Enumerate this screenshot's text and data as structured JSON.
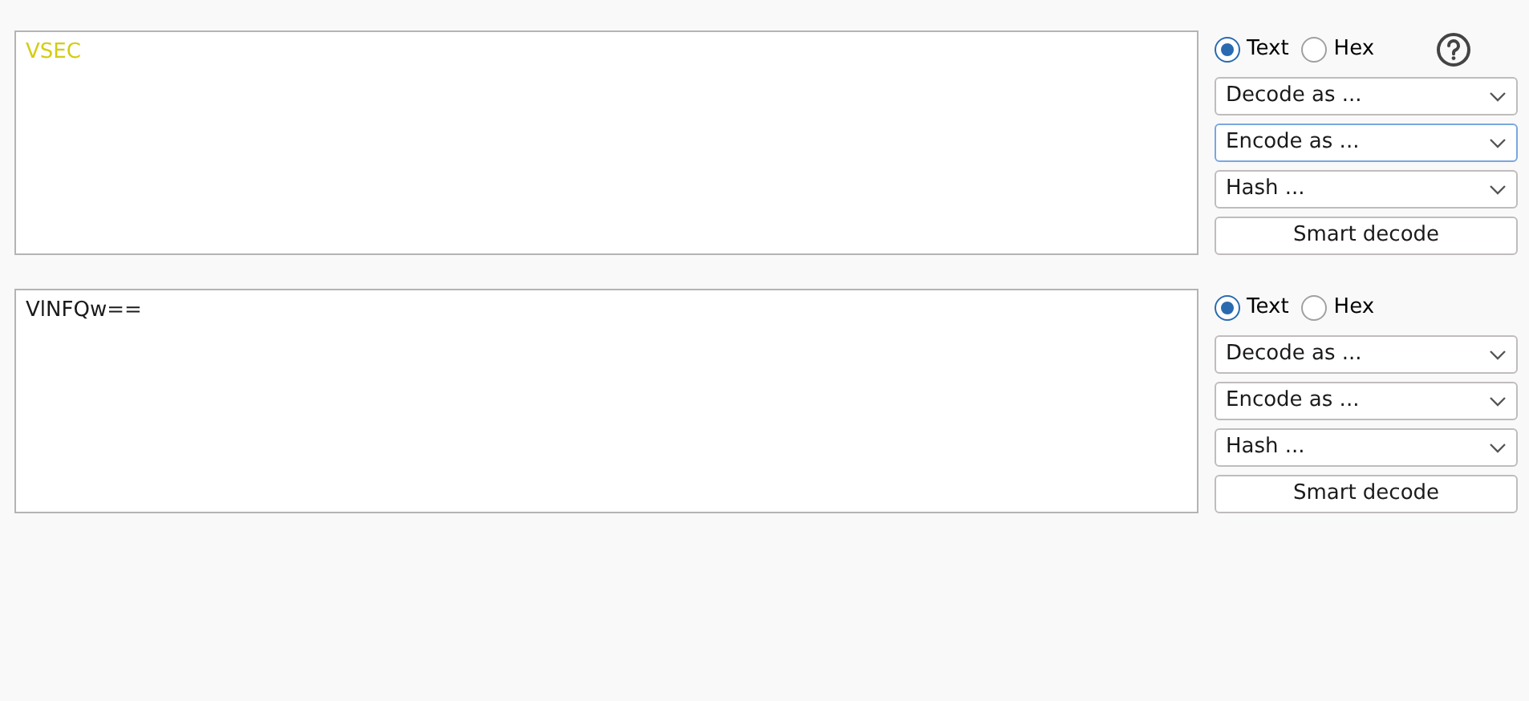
{
  "panels": [
    {
      "text": "VSEC",
      "highlighted": true,
      "help": true,
      "formats": [
        {
          "label": "Text",
          "selected": true
        },
        {
          "label": "Hex",
          "selected": false
        }
      ],
      "selects": [
        {
          "label": "Decode as ...",
          "focused": false
        },
        {
          "label": "Encode as ...",
          "focused": true
        },
        {
          "label": "Hash ...",
          "focused": false
        }
      ],
      "button": "Smart decode"
    },
    {
      "text": "VlNFQw==",
      "highlighted": false,
      "help": false,
      "formats": [
        {
          "label": "Text",
          "selected": true
        },
        {
          "label": "Hex",
          "selected": false
        }
      ],
      "selects": [
        {
          "label": "Decode as ...",
          "focused": false
        },
        {
          "label": "Encode as ...",
          "focused": false
        },
        {
          "label": "Hash ...",
          "focused": false
        }
      ],
      "button": "Smart decode"
    }
  ]
}
